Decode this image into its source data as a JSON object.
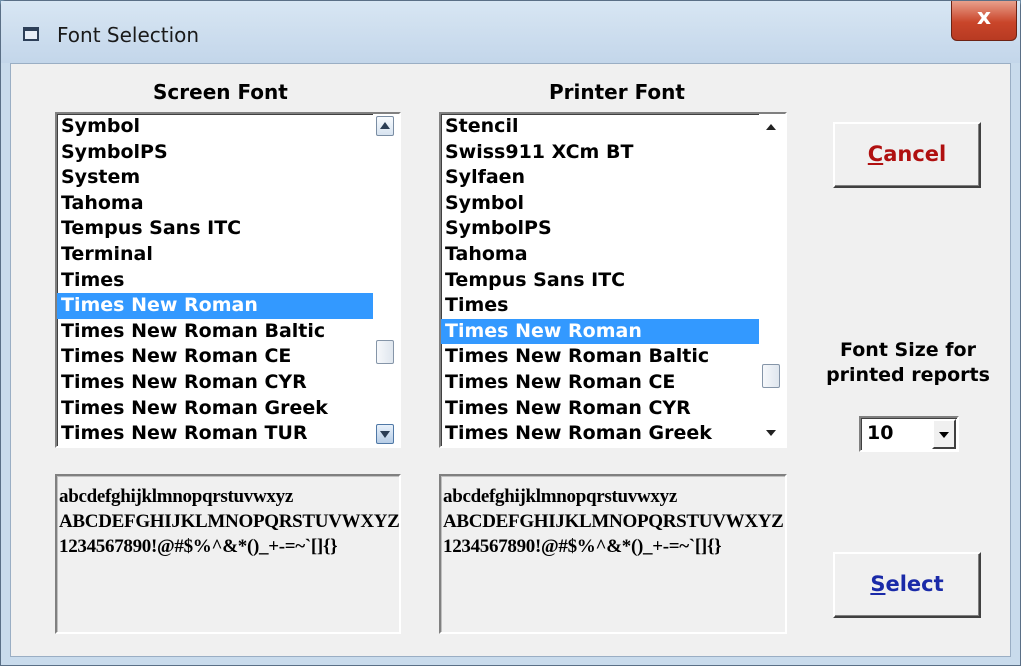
{
  "window": {
    "title": "Font Selection",
    "close_label": "x"
  },
  "screen_font": {
    "label": "Screen Font",
    "items": [
      "Symbol",
      "SymbolPS",
      "System",
      "Tahoma",
      "Tempus Sans ITC",
      "Terminal",
      "Times",
      "Times New Roman",
      "Times New Roman Baltic",
      "Times New Roman CE",
      "Times New Roman CYR",
      "Times New Roman Greek",
      "Times New Roman TUR"
    ],
    "selected": "Times New Roman",
    "preview": [
      "abcdefghijklmnopqrstuvwxyz",
      "ABCDEFGHIJKLMNOPQRSTUVWXYZ",
      "1234567890!@#$%^&*()_+-=~`[]{}"
    ]
  },
  "printer_font": {
    "label": "Printer Font",
    "items": [
      "Stencil",
      "Swiss911 XCm BT",
      "Sylfaen",
      "Symbol",
      "SymbolPS",
      "Tahoma",
      "Tempus Sans ITC",
      "Times",
      "Times New Roman",
      "Times New Roman Baltic",
      "Times New Roman CE",
      "Times New Roman CYR",
      "Times New Roman Greek"
    ],
    "selected": "Times New Roman",
    "preview": [
      "abcdefghijklmnopqrstuvwxyz",
      "ABCDEFGHIJKLMNOPQRSTUVWXYZ",
      "1234567890!@#$%^&*()_+-=~`[]{}"
    ]
  },
  "buttons": {
    "cancel_accel": "C",
    "cancel_rest": "ancel",
    "select_accel": "S",
    "select_rest": "elect"
  },
  "font_size": {
    "label_line1": "Font Size for",
    "label_line2": "printed reports",
    "value": "10"
  },
  "colors": {
    "selection": "#3399ff",
    "cancel_text": "#b01010",
    "select_text": "#1a2aa8"
  }
}
